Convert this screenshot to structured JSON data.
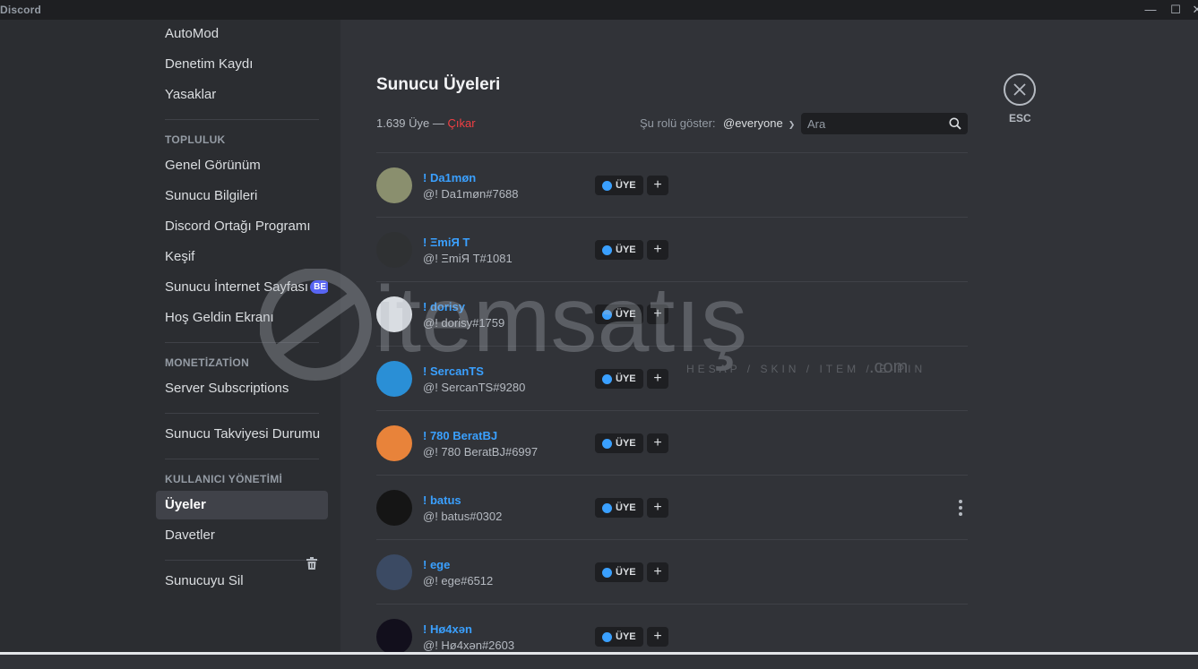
{
  "window": {
    "title": "Discord",
    "minimize": "—",
    "maximize": "☐",
    "close": "✕"
  },
  "sidebar": {
    "items_top": [
      {
        "label": "AutoMod"
      },
      {
        "label": "Denetim Kaydı"
      },
      {
        "label": "Yasaklar"
      }
    ],
    "community_header": "TOPLULUK",
    "community_items": [
      {
        "label": "Genel Görünüm"
      },
      {
        "label": "Sunucu Bilgileri"
      },
      {
        "label": "Discord Ortağı Programı"
      },
      {
        "label": "Keşif"
      },
      {
        "label": "Sunucu İnternet Sayfası",
        "badge": "BE"
      },
      {
        "label": "Hoş Geldin Ekranı"
      }
    ],
    "monetization_header": "MONETİZATİON",
    "monetization_items": [
      {
        "label": "Server Subscriptions"
      }
    ],
    "boost_item": {
      "label": "Sunucu Takviyesi Durumu"
    },
    "user_mgmt_header": "KULLANICI YÖNETİMİ",
    "user_mgmt_items": [
      {
        "label": "Üyeler",
        "active": true
      },
      {
        "label": "Davetler"
      }
    ],
    "delete_server": {
      "label": "Sunucuyu Sil",
      "icon": "trash-icon"
    }
  },
  "main": {
    "title": "Sunucu Üyeleri",
    "member_count": "1.639 Üye — ",
    "prune_label": "Çıkar",
    "role_filter_label": "Şu rolü göster:",
    "role_filter_value": "@everyone",
    "search_placeholder": "Ara",
    "close_label": "ESC"
  },
  "members": [
    {
      "name": "! Da1møn",
      "tag": "@! Da1møn#7688",
      "role": "ÜYE",
      "avatar_color": "#8a8f6e"
    },
    {
      "name": "! ΞmiЯ T",
      "tag": "@! ΞmiЯ T#1081",
      "role": "ÜYE",
      "avatar_color": "#2f3133"
    },
    {
      "name": "! dorisy",
      "tag": "@! dorisy#1759",
      "role": "ÜYE",
      "avatar_color": "#d9dde2"
    },
    {
      "name": "! SercanTS",
      "tag": "@! SercanTS#9280",
      "role": "ÜYE",
      "avatar_color": "#2a8fd6"
    },
    {
      "name": "! 780 BeratBJ",
      "tag": "@! 780 BeratBJ#6997",
      "role": "ÜYE",
      "avatar_color": "#e8833a"
    },
    {
      "name": "! batus",
      "tag": "@! batus#0302",
      "role": "ÜYE",
      "avatar_color": "#151515"
    },
    {
      "name": "! ege",
      "tag": "@! ege#6512",
      "role": "ÜYE",
      "avatar_color": "#3b4a63"
    },
    {
      "name": "! Hø4xən",
      "tag": "@! Hø4xən#2603",
      "role": "ÜYE",
      "avatar_color": "#120f1c"
    }
  ],
  "watermark": {
    "brand": "itemsatış",
    "tagline": "HESAP / SKIN / ITEM / E-PIN",
    "suffix": ".com"
  },
  "colors": {
    "accent": "#5865f2",
    "role_dot": "#3aa0ff",
    "danger": "#f23f43",
    "name": "#3aa0ff"
  }
}
